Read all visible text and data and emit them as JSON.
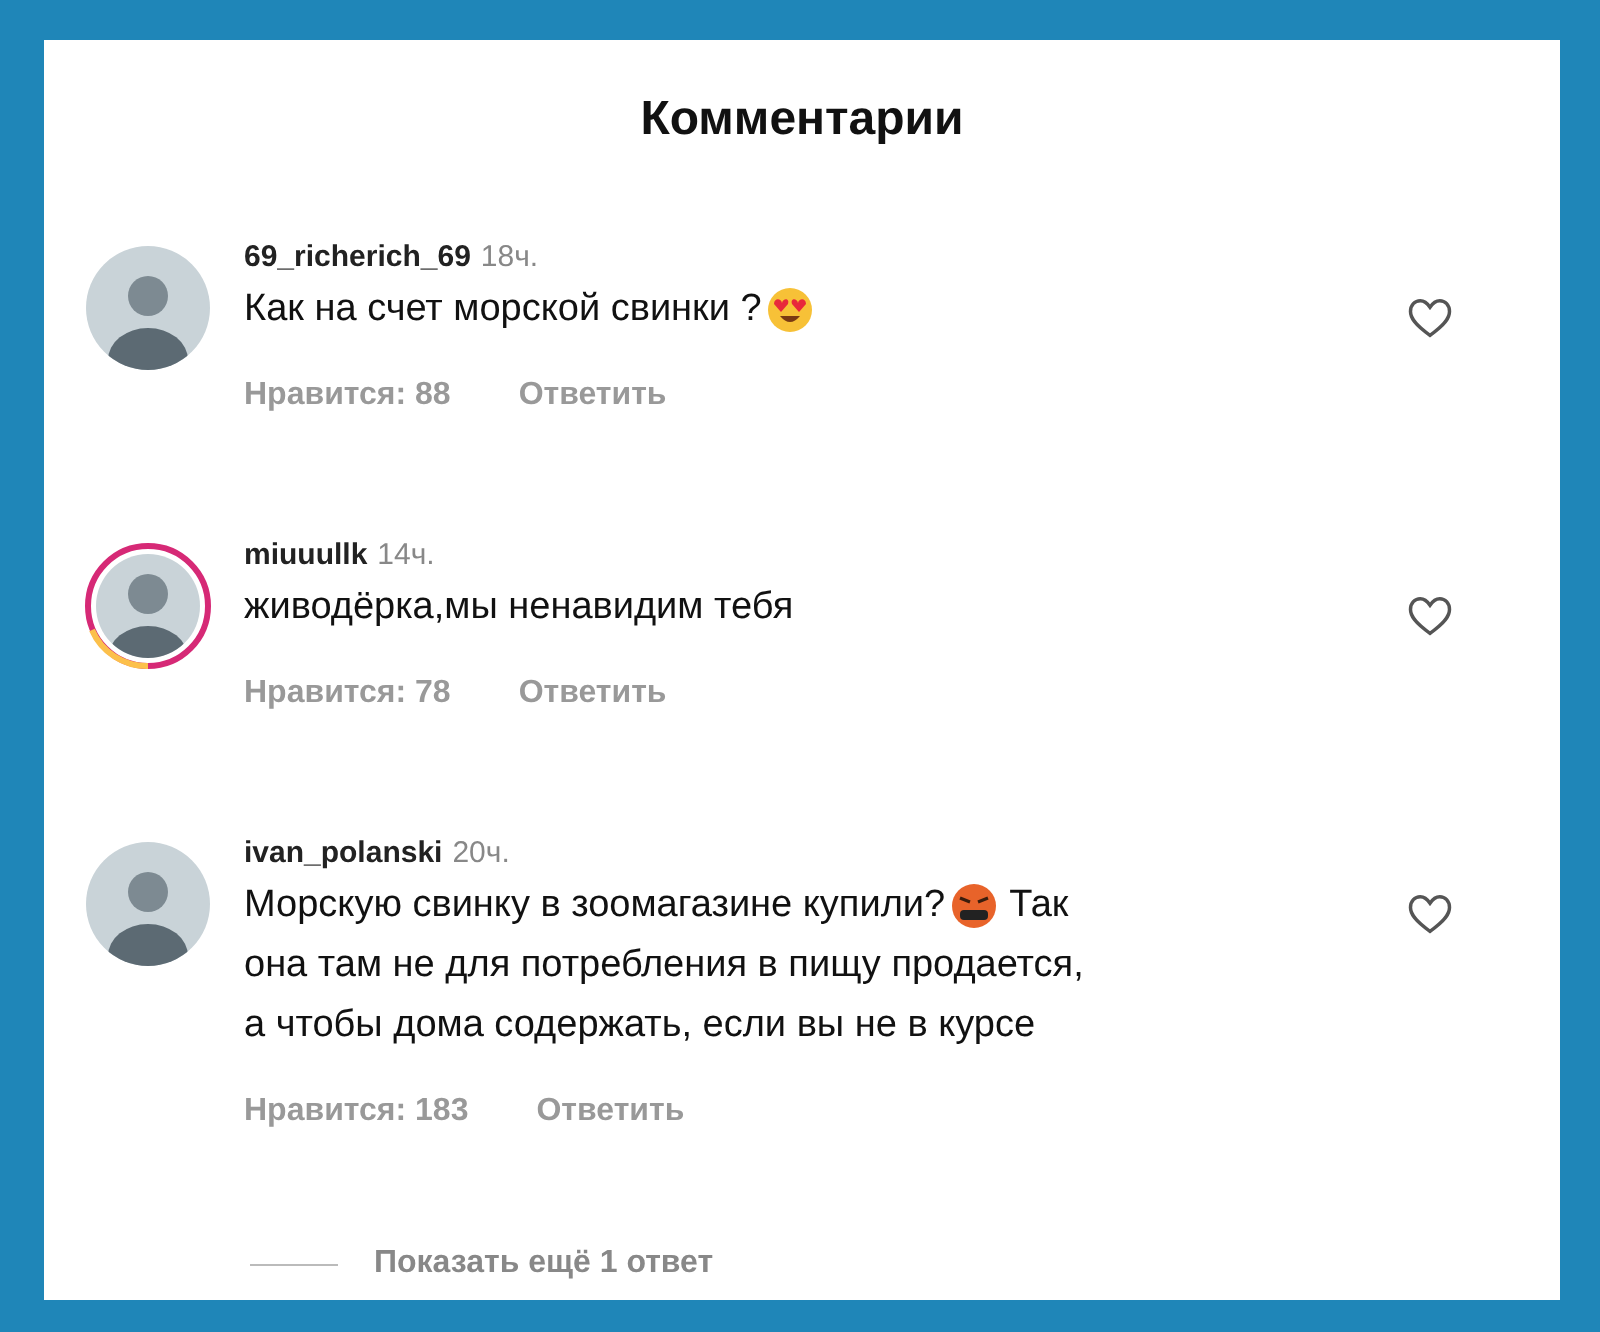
{
  "title": "Комментарии",
  "comments": [
    {
      "username": "69_richerich_69",
      "time": "18ч.",
      "story": false,
      "liked": false,
      "lines": [
        [
          {
            "kind": "text",
            "text": "Как на счет морской свинки ?"
          },
          {
            "kind": "heart-eyes"
          }
        ]
      ],
      "likes": "Нравится: 88",
      "reply": "Ответить"
    },
    {
      "username": "miuuullk",
      "time": "14ч.",
      "story": true,
      "liked": false,
      "lines": [
        [
          {
            "kind": "text",
            "text": "живодёрка,мы ненавидим тебя"
          }
        ]
      ],
      "likes": "Нравится: 78",
      "reply": "Ответить"
    },
    {
      "username": "ivan_polanski",
      "time": "20ч.",
      "story": false,
      "liked": false,
      "lines": [
        [
          {
            "kind": "text",
            "text": "Морскую свинку в зоомагазине купили?"
          },
          {
            "kind": "angry"
          },
          {
            "kind": "text",
            "text": "Так"
          }
        ],
        [
          {
            "kind": "text",
            "text": "она там не для потребления в пищу продается,"
          }
        ],
        [
          {
            "kind": "text",
            "text": "а чтобы дома содержать, если вы не в курсе"
          }
        ]
      ],
      "likes": "Нравится: 183",
      "reply": "Ответить"
    }
  ],
  "show_replies": "Показать ещё 1 ответ"
}
